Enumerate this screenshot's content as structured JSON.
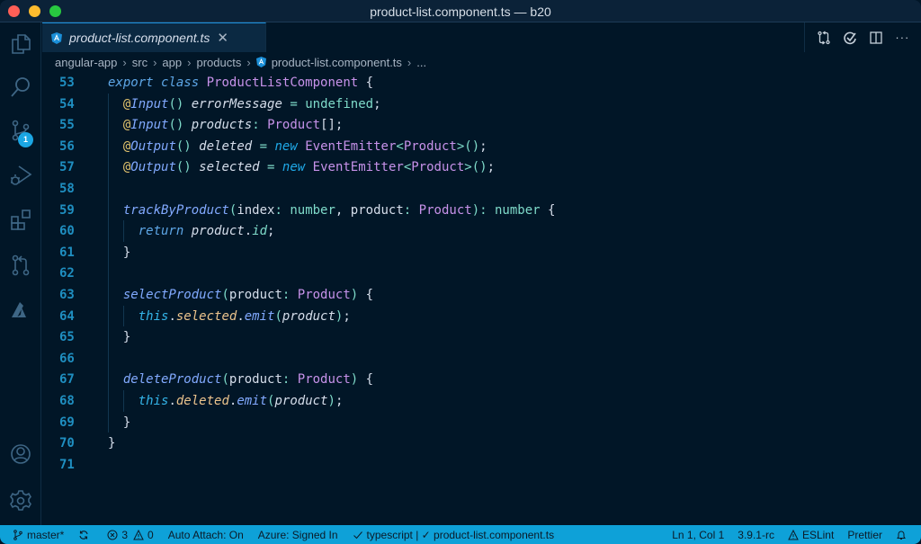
{
  "window": {
    "title": "product-list.component.ts — b20"
  },
  "activity_bar": {
    "items": [
      {
        "name": "explorer",
        "icon": "files-icon"
      },
      {
        "name": "search",
        "icon": "search-icon"
      },
      {
        "name": "source-control",
        "icon": "source-control-icon",
        "badge": "1"
      },
      {
        "name": "run-debug",
        "icon": "run-debug-icon"
      },
      {
        "name": "extensions",
        "icon": "extensions-icon"
      },
      {
        "name": "pull-requests",
        "icon": "pull-request-icon"
      },
      {
        "name": "azure",
        "icon": "azure-icon"
      }
    ],
    "bottom": [
      {
        "name": "accounts",
        "icon": "account-icon"
      },
      {
        "name": "manage",
        "icon": "gear-icon"
      }
    ]
  },
  "tabs": [
    {
      "label": "product-list.component.ts",
      "icon": "angular-icon",
      "active": true,
      "close": "✕"
    }
  ],
  "editor_actions": [
    {
      "name": "open-changes",
      "icon": "compare-changes-icon"
    },
    {
      "name": "review",
      "icon": "check-circle-icon"
    },
    {
      "name": "split-editor",
      "icon": "split-editor-icon"
    },
    {
      "name": "more-actions",
      "icon": "ellipsis-icon",
      "glyph": "···"
    }
  ],
  "breadcrumb": {
    "items": [
      "angular-app",
      "src",
      "app",
      "products",
      "product-list.component.ts",
      "..."
    ],
    "separator": "›"
  },
  "code": {
    "lines": [
      {
        "n": "53",
        "indent": 0,
        "tokens": [
          [
            "kw",
            "export"
          ],
          [
            "plain",
            " "
          ],
          [
            "kw",
            "class"
          ],
          [
            "plain",
            " "
          ],
          [
            "cls",
            "ProductListComponent"
          ],
          [
            "plain",
            " {"
          ]
        ]
      },
      {
        "n": "54",
        "indent": 1,
        "tokens": [
          [
            "dec",
            "@"
          ],
          [
            "decname",
            "Input"
          ],
          [
            "paren",
            "()"
          ],
          [
            "plain",
            " "
          ],
          [
            "prop",
            "errorMessage"
          ],
          [
            "plain",
            " "
          ],
          [
            "op",
            "="
          ],
          [
            "plain",
            " "
          ],
          [
            "type",
            "undefined"
          ],
          [
            "plain",
            ";"
          ]
        ]
      },
      {
        "n": "55",
        "indent": 1,
        "tokens": [
          [
            "dec",
            "@"
          ],
          [
            "decname",
            "Input"
          ],
          [
            "paren",
            "()"
          ],
          [
            "plain",
            " "
          ],
          [
            "prop",
            "products"
          ],
          [
            "op",
            ":"
          ],
          [
            "plain",
            " "
          ],
          [
            "cls",
            "Product"
          ],
          [
            "plain",
            "[];"
          ]
        ]
      },
      {
        "n": "56",
        "indent": 1,
        "tokens": [
          [
            "dec",
            "@"
          ],
          [
            "decname",
            "Output"
          ],
          [
            "paren",
            "()"
          ],
          [
            "plain",
            " "
          ],
          [
            "prop",
            "deleted"
          ],
          [
            "plain",
            " "
          ],
          [
            "op",
            "="
          ],
          [
            "plain",
            " "
          ],
          [
            "new",
            "new"
          ],
          [
            "plain",
            " "
          ],
          [
            "cls",
            "EventEmitter"
          ],
          [
            "op",
            "<"
          ],
          [
            "cls",
            "Product"
          ],
          [
            "op",
            ">"
          ],
          [
            "paren",
            "()"
          ],
          [
            "plain",
            ";"
          ]
        ]
      },
      {
        "n": "57",
        "indent": 1,
        "tokens": [
          [
            "dec",
            "@"
          ],
          [
            "decname",
            "Output"
          ],
          [
            "paren",
            "()"
          ],
          [
            "plain",
            " "
          ],
          [
            "prop",
            "selected"
          ],
          [
            "plain",
            " "
          ],
          [
            "op",
            "="
          ],
          [
            "plain",
            " "
          ],
          [
            "new",
            "new"
          ],
          [
            "plain",
            " "
          ],
          [
            "cls",
            "EventEmitter"
          ],
          [
            "op",
            "<"
          ],
          [
            "cls",
            "Product"
          ],
          [
            "op",
            ">"
          ],
          [
            "paren",
            "()"
          ],
          [
            "plain",
            ";"
          ]
        ]
      },
      {
        "n": "58",
        "indent": 0,
        "tokens": []
      },
      {
        "n": "59",
        "indent": 1,
        "tokens": [
          [
            "fn",
            "trackByProduct"
          ],
          [
            "paren",
            "("
          ],
          [
            "param",
            "index"
          ],
          [
            "op",
            ":"
          ],
          [
            "plain",
            " "
          ],
          [
            "type",
            "number"
          ],
          [
            "plain",
            ", "
          ],
          [
            "param",
            "product"
          ],
          [
            "op",
            ":"
          ],
          [
            "plain",
            " "
          ],
          [
            "cls",
            "Product"
          ],
          [
            "paren",
            ")"
          ],
          [
            "op",
            ":"
          ],
          [
            "plain",
            " "
          ],
          [
            "type",
            "number"
          ],
          [
            "plain",
            " {"
          ]
        ]
      },
      {
        "n": "60",
        "indent": 2,
        "tokens": [
          [
            "kw",
            "return"
          ],
          [
            "plain",
            " "
          ],
          [
            "prop",
            "product"
          ],
          [
            "plain",
            "."
          ],
          [
            "id",
            "id"
          ],
          [
            "plain",
            ";"
          ]
        ]
      },
      {
        "n": "61",
        "indent": 1,
        "tokens": [
          [
            "plain",
            "}"
          ]
        ]
      },
      {
        "n": "62",
        "indent": 0,
        "tokens": []
      },
      {
        "n": "63",
        "indent": 1,
        "tokens": [
          [
            "fn",
            "selectProduct"
          ],
          [
            "paren",
            "("
          ],
          [
            "param",
            "product"
          ],
          [
            "op",
            ":"
          ],
          [
            "plain",
            " "
          ],
          [
            "cls",
            "Product"
          ],
          [
            "paren",
            ")"
          ],
          [
            "plain",
            " {"
          ]
        ]
      },
      {
        "n": "64",
        "indent": 2,
        "tokens": [
          [
            "this",
            "this"
          ],
          [
            "plain",
            "."
          ],
          [
            "field",
            "selected"
          ],
          [
            "plain",
            "."
          ],
          [
            "fn",
            "emit"
          ],
          [
            "paren",
            "("
          ],
          [
            "prop",
            "product"
          ],
          [
            "paren",
            ")"
          ],
          [
            "plain",
            ";"
          ]
        ]
      },
      {
        "n": "65",
        "indent": 1,
        "tokens": [
          [
            "plain",
            "}"
          ]
        ]
      },
      {
        "n": "66",
        "indent": 0,
        "tokens": []
      },
      {
        "n": "67",
        "indent": 1,
        "tokens": [
          [
            "fn",
            "deleteProduct"
          ],
          [
            "paren",
            "("
          ],
          [
            "param",
            "product"
          ],
          [
            "op",
            ":"
          ],
          [
            "plain",
            " "
          ],
          [
            "cls",
            "Product"
          ],
          [
            "paren",
            ")"
          ],
          [
            "plain",
            " {"
          ]
        ]
      },
      {
        "n": "68",
        "indent": 2,
        "tokens": [
          [
            "this",
            "this"
          ],
          [
            "plain",
            "."
          ],
          [
            "field",
            "deleted"
          ],
          [
            "plain",
            "."
          ],
          [
            "fn",
            "emit"
          ],
          [
            "paren",
            "("
          ],
          [
            "prop",
            "product"
          ],
          [
            "paren",
            ")"
          ],
          [
            "plain",
            ";"
          ]
        ]
      },
      {
        "n": "69",
        "indent": 1,
        "tokens": [
          [
            "plain",
            "}"
          ]
        ]
      },
      {
        "n": "70",
        "indent": 0,
        "tokens": [
          [
            "plain",
            "}"
          ]
        ]
      },
      {
        "n": "71",
        "indent": 0,
        "tokens": []
      }
    ]
  },
  "status_bar": {
    "branch": "master*",
    "sync_icon": "sync-icon",
    "errors": "3",
    "warnings": "0",
    "auto_attach": "Auto Attach: On",
    "azure": "Azure: Signed In",
    "language_check": "typescript | ✓ product-list.component.ts",
    "position": "Ln 1, Col 1",
    "ts_version": "3.9.1-rc",
    "eslint": "ESLint",
    "prettier": "Prettier",
    "notifications_icon": "bell-icon"
  },
  "colors": {
    "background": "#011627",
    "accent": "#0ea1d8",
    "line_numbers": "#1f8fc1"
  }
}
